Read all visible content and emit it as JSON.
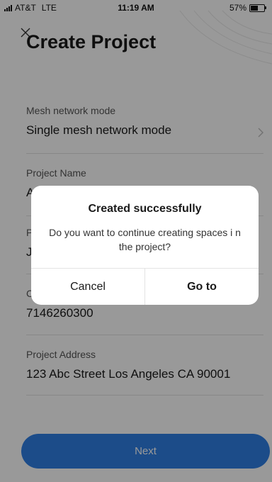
{
  "status": {
    "carrier": "AT&T",
    "network": "LTE",
    "time": "11:19 AM",
    "battery_percent": "57%",
    "battery_level": 0.57
  },
  "header": {
    "title": "Create Project"
  },
  "fields": [
    {
      "label": "Mesh network mode",
      "value": "Single mesh network mode"
    },
    {
      "label": "Project Name",
      "value": "A"
    },
    {
      "label": "P",
      "value": "J"
    },
    {
      "label": "C",
      "value": "7146260300"
    },
    {
      "label": "Project Address",
      "value": "123 Abc Street Los Angeles CA 90001"
    }
  ],
  "footer": {
    "next_label": "Next"
  },
  "dialog": {
    "title": "Created successfully",
    "message": "Do you want to continue creating spaces i n the project?",
    "cancel_label": "Cancel",
    "goto_label": "Go to"
  },
  "colors": {
    "accent": "#2f7fe4",
    "overlay": "rgba(0,0,0,0.4)"
  },
  "icons": {
    "close": "close-icon",
    "chevron": "chevron-right-icon",
    "signal": "signal-icon",
    "battery": "battery-icon"
  }
}
